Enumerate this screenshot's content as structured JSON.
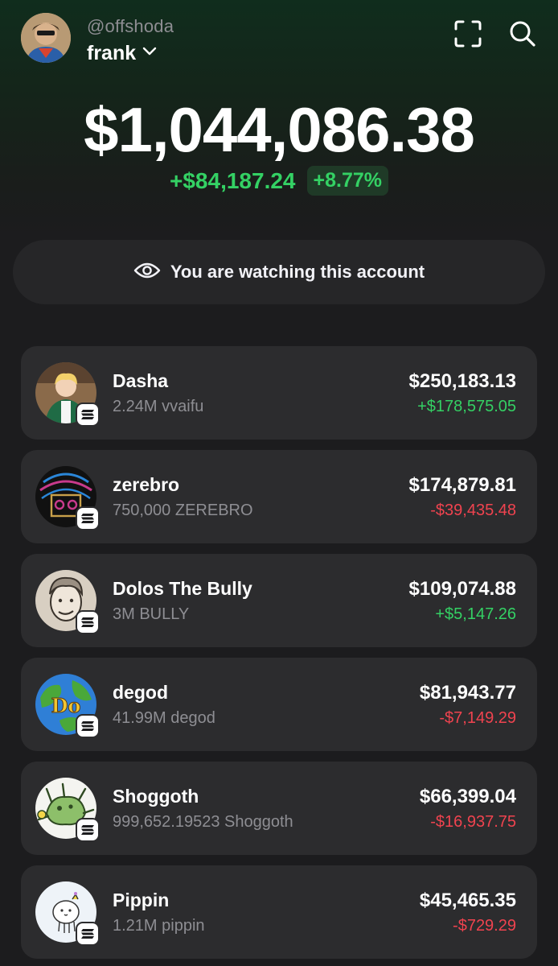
{
  "header": {
    "handle": "@offshoda",
    "account_name": "frank",
    "avatar_icon": "avatar-portrait",
    "scan_icon": "scan-icon",
    "search_icon": "search-icon"
  },
  "portfolio": {
    "balance": "$1,044,086.38",
    "change_abs": "+$84,187.24",
    "change_pct": "+8.77%"
  },
  "watch_banner": {
    "icon": "eye-icon",
    "text": "You are watching this account"
  },
  "tokens": [
    {
      "name": "Dasha",
      "amount": "2.24M vvaifu",
      "value": "$250,183.13",
      "pnl": "+$178,575.05",
      "pnl_direction": "positive"
    },
    {
      "name": "zerebro",
      "amount": "750,000 ZEREBRO",
      "value": "$174,879.81",
      "pnl": "-$39,435.48",
      "pnl_direction": "negative"
    },
    {
      "name": "Dolos The Bully",
      "amount": "3M BULLY",
      "value": "$109,074.88",
      "pnl": "+$5,147.26",
      "pnl_direction": "positive"
    },
    {
      "name": "degod",
      "amount": "41.99M degod",
      "value": "$81,943.77",
      "pnl": "-$7,149.29",
      "pnl_direction": "negative"
    },
    {
      "name": "Shoggoth",
      "amount": "999,652.19523 Shoggoth",
      "value": "$66,399.04",
      "pnl": "-$16,937.75",
      "pnl_direction": "negative"
    },
    {
      "name": "Pippin",
      "amount": "1.21M pippin",
      "value": "$45,465.35",
      "pnl": "-$729.29",
      "pnl_direction": "negative"
    }
  ],
  "chain_badge_icon": "solana-icon",
  "colors": {
    "positive": "#34d164",
    "negative": "#f0434f",
    "card": "#2c2c2e",
    "background": "#1c1c1e",
    "header_gradient_top": "#102d1d"
  }
}
